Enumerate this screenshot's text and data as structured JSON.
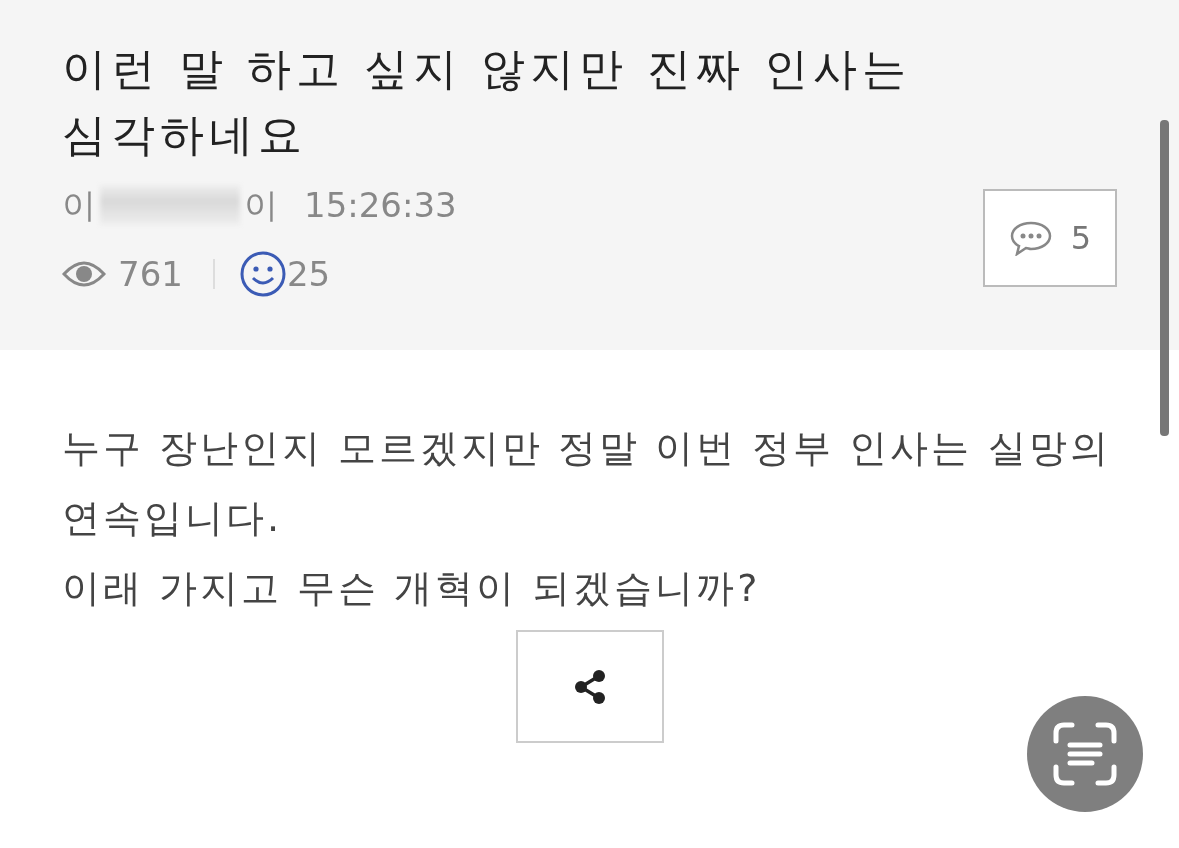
{
  "post": {
    "title": "이런 말 하고 싶지 않지만 진짜 인사는 심각하네요",
    "author_start": "이",
    "author_end": "이",
    "time": "15:26:33",
    "views": "761",
    "likes": "25",
    "comments": "5"
  },
  "body": {
    "paragraphs": [
      "누구 장난인지 모르겠지만 정말 이번 정부 인사는 실망의 연속입니다.",
      "이래 가지고 무슨 개혁이 되겠습니까?"
    ]
  }
}
